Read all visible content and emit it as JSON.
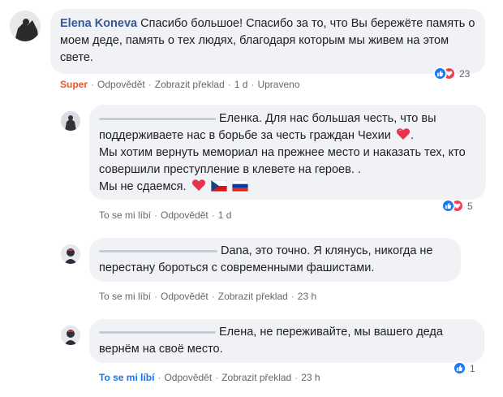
{
  "comments": [
    {
      "author": "Elena Koneva",
      "text": "Спасибо большое! Спасибо за то, что Вы бережёте память о моем деде, память о тех людях, благодаря которым мы живем на этом свете.",
      "actions": {
        "super": "Super",
        "reply": "Odpovědět",
        "translate": "Zobrazit překlad",
        "time": "1 d",
        "edited": "Upraveno"
      },
      "reaction_count": "23"
    },
    {
      "text_line1": "Еленка. Для нас большая честь, что вы",
      "text_rest": "поддерживаете нас в борьбе за честь граждан Чехии",
      "text_line3": "Мы хотим вернуть мемориал на прежнее место и наказать тех, кто совершили преступление в клевете на героев. .",
      "text_line4": "Мы не сдаемся.",
      "actions": {
        "like": "To se mi líbí",
        "reply": "Odpovědět",
        "time": "1 d"
      },
      "reaction_count": "5"
    },
    {
      "text_line1": "Dana, это точно. Я клянусь, никогда не",
      "text_line2": "перестану бороться с современными фашистами.",
      "actions": {
        "like": "To se mi líbí",
        "reply": "Odpovědět",
        "translate": "Zobrazit překlad",
        "time": "23 h"
      }
    },
    {
      "text_line1": "Елена, не переживайте, мы вашего деда",
      "text_line2": "вернём на своё место.",
      "actions": {
        "like": "To se mi líbí",
        "reply": "Odpovědět",
        "translate": "Zobrazit překlad",
        "time": "23 h"
      },
      "reaction_count": "1"
    }
  ],
  "colors": {
    "link": "#385898",
    "like_blue": "#1877f2",
    "love_red": "#f33e58",
    "super_orange": "#e9572e",
    "bubble_bg": "#f0f2f5"
  },
  "icons": [
    "like-icon",
    "love-icon",
    "heart-emoji",
    "czech-flag",
    "russian-flag"
  ]
}
